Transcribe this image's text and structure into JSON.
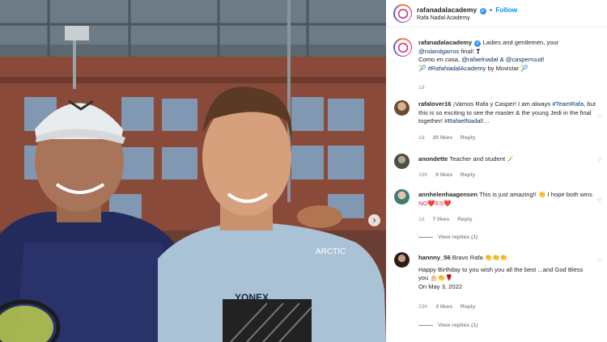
{
  "post": {
    "account": "rafanadalacademy",
    "follow_label": "Follow",
    "subtitle": "Rafa Nadal Academy",
    "caption_user": "rafanadalacademy",
    "caption_line1": "Ladies and gentlemen, your",
    "caption_mention": "@rolandgarros",
    "caption_line2": "final! ❣",
    "caption_line3_a": "Como en casa, ",
    "caption_mention2": "@rafaelnadal",
    "caption_line3_b": " & ",
    "caption_mention3": "@casperruud",
    "caption_line3_c": "!",
    "caption_line4_a": "🎾 ",
    "caption_hashtag": "#RafaNadalAcademy",
    "caption_line4_b": " by Movistar 🎾",
    "caption_time": "1d"
  },
  "comments": [
    {
      "user": "rafalover16",
      "text_a": " ¡Vamos Rafa y Casper! I am always ",
      "tag1": "#TeamRafa",
      "text_b": ", but this is so exciting to see the master & the young Jedi in the final together! ",
      "tag2": "#RafaelNadal",
      "text_c": "!…",
      "time": "1d",
      "likes": "20 likes",
      "reply": "Reply"
    },
    {
      "user": "anondette",
      "text": " Teacher and student 🪄",
      "time": "16h",
      "likes": "9 likes",
      "reply": "Reply"
    },
    {
      "user": "annhelenhaagensen",
      "text": " This is just amazing!! 👏 I hope both wins",
      "text2": "NO❤️ES❤️",
      "time": "1d",
      "likes": "7 likes",
      "reply": "Reply",
      "view_replies": "View replies (1)"
    },
    {
      "user": "hannny_56",
      "text": " Bravo Rafa 👏👏👏",
      "line2": "Happy Birthday to you wish you all the best ...and God Bless",
      "line3": "you 🎂👏🌹",
      "line4": "On May 3, 2022",
      "time": "23h",
      "likes": "3 likes",
      "reply": "Reply",
      "view_replies": "View replies (1)"
    }
  ],
  "photo": {
    "shirt_brand": "YONEX",
    "shirt_logo_text": "ARCTIC"
  },
  "colors": {
    "link": "#0095f6",
    "mention": "#00376b",
    "muted": "#8e8e8e",
    "verified": "#3897f0"
  },
  "icons": [
    "verified-badge-icon",
    "next-arrow-icon",
    "heart-icon"
  ]
}
